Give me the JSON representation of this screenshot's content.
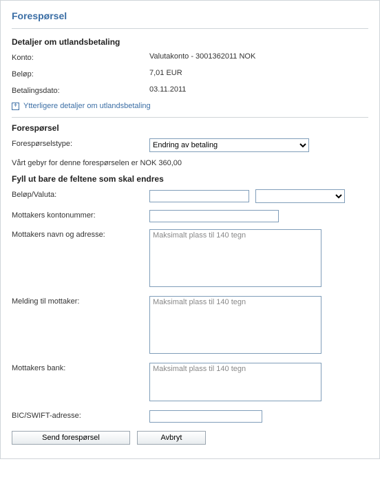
{
  "pageTitle": "Forespørsel",
  "details": {
    "heading": "Detaljer om utlandsbetaling",
    "accountLabel": "Konto:",
    "accountValue": "Valutakonto - 3001362011 NOK",
    "amountLabel": "Beløp:",
    "amountValue": "7,01 EUR",
    "dateLabel": "Betalingsdato:",
    "dateValue": "03.11.2011",
    "expandLabel": "Ytterligere detaljer om utlandsbetaling"
  },
  "request": {
    "heading": "Forespørsel",
    "typeLabel": "Forespørselstype:",
    "typeSelected": "Endring av betaling",
    "feeText": "Vårt gebyr for denne forespørselen er NOK 360,00"
  },
  "form": {
    "heading": "Fyll ut bare de feltene som skal endres",
    "amountLabel": "Beløp/Valuta:",
    "accountLabel": "Mottakers kontonummer:",
    "nameLabel": "Mottakers navn og adresse:",
    "messageLabel": "Melding til mottaker:",
    "bankLabel": "Mottakers bank:",
    "bicLabel": "BIC/SWIFT-adresse:",
    "placeholder140": "Maksimalt plass til 140 tegn",
    "currencySelected": ""
  },
  "buttons": {
    "send": "Send forespørsel",
    "cancel": "Avbryt"
  }
}
